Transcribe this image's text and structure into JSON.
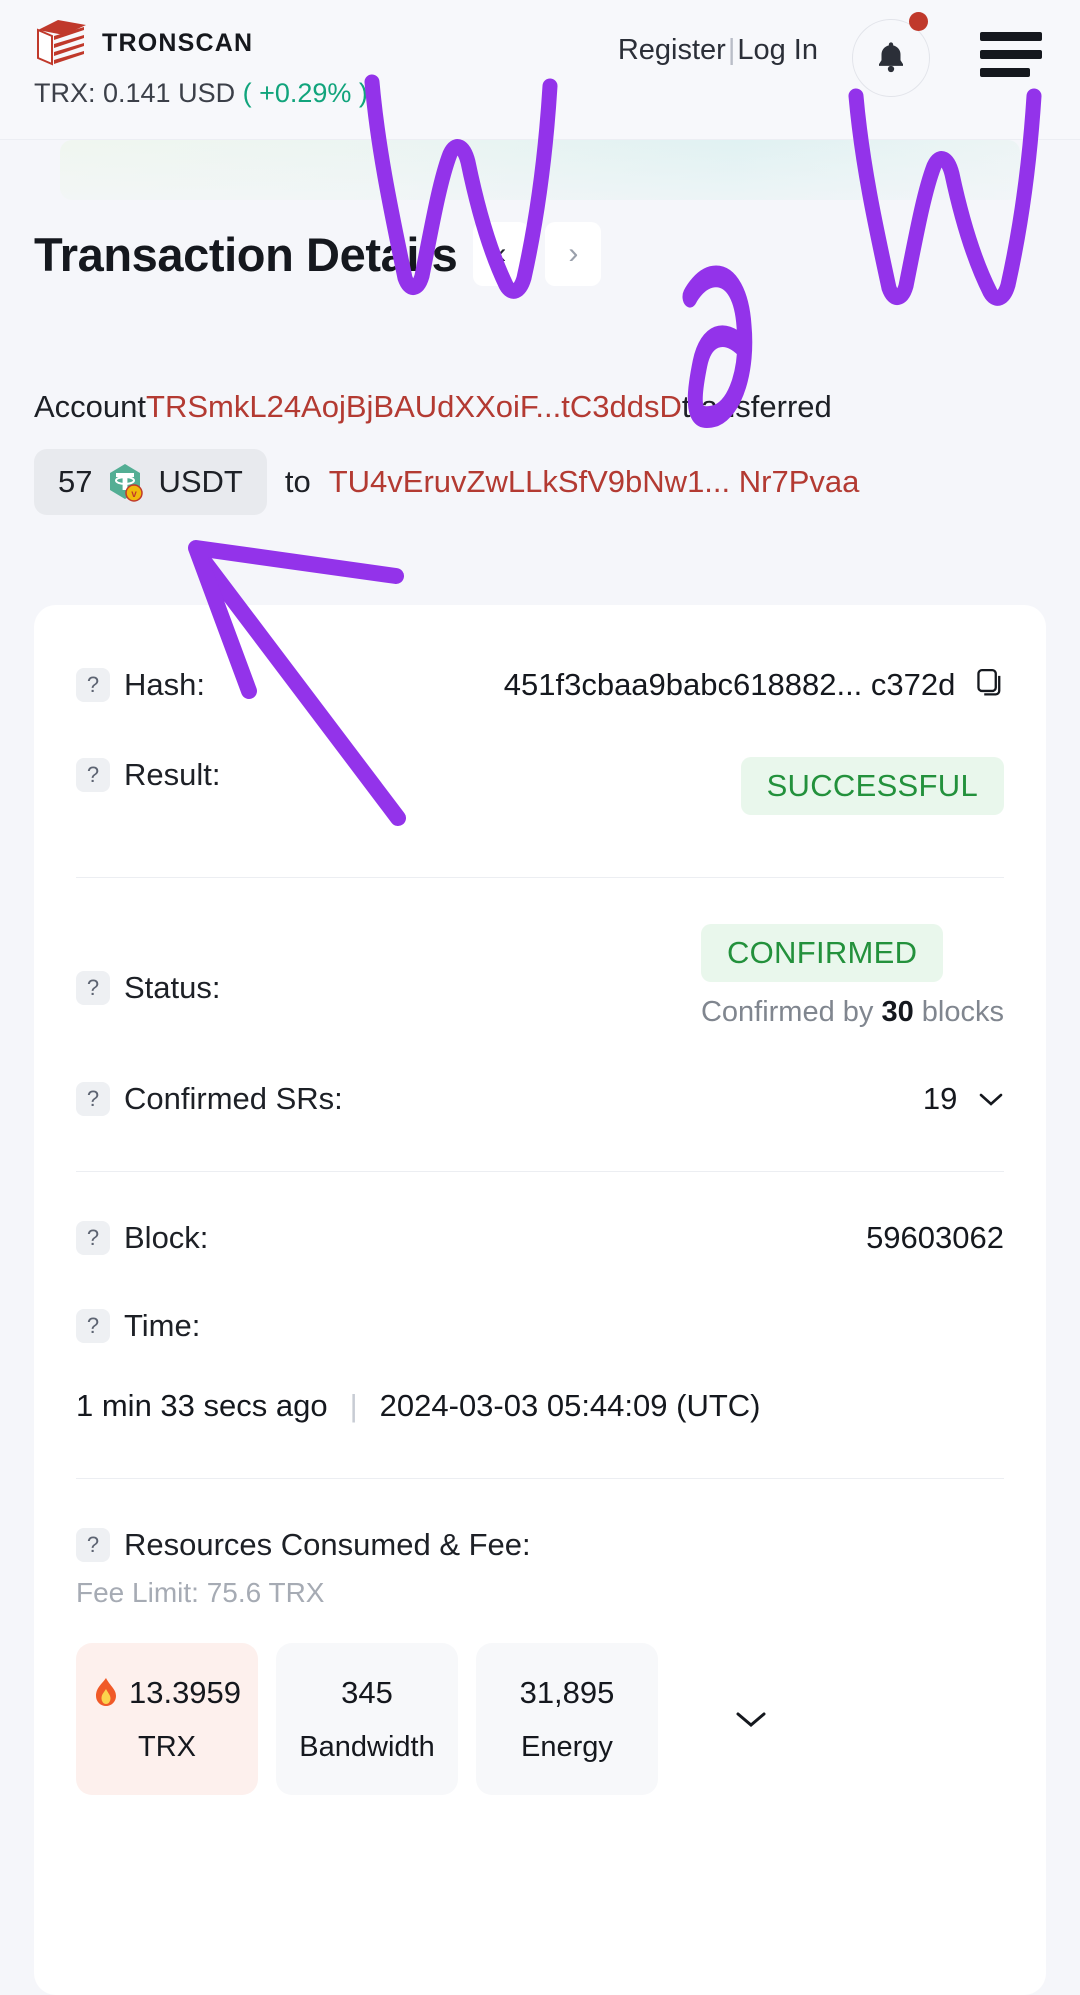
{
  "header": {
    "brand": "TRONSCAN",
    "logo_icon": "tronscan-logo-icon",
    "price_label": "TRX: 0.141 USD",
    "price_change": "( +0.29% )",
    "register_label": "Register",
    "separator": "|",
    "login_label": "Log In",
    "bell_icon": "bell-icon",
    "menu_icon": "hamburger-menu-icon",
    "accent_green": "#11a47c"
  },
  "page": {
    "title": "Transaction Details",
    "prev_icon": "chevron-left-icon",
    "next_icon": "chevron-right-icon"
  },
  "summary": {
    "account_word": "Account",
    "from_address": "TRSmkL24AojBjBAUdXXoiF...tC3ddsD",
    "transferred_word": "transferred",
    "amount": "57",
    "token_icon": "usdt-token-icon",
    "token_symbol": "USDT",
    "to_word": "to",
    "to_address": "TU4vEruvZwLLkSfV9bNw1...  Nr7Pvaa",
    "address_color": "#b33a32"
  },
  "details": {
    "hash": {
      "label": "Hash:",
      "value": "451f3cbaa9babc618882... c372d",
      "copy_icon": "copy-icon"
    },
    "result": {
      "label": "Result:",
      "badge": "SUCCESSFUL",
      "badge_color": "#23913c",
      "badge_bg": "#e9f7ec"
    },
    "status": {
      "label": "Status:",
      "badge": "CONFIRMED",
      "note_prefix": "Confirmed by",
      "note_count": "30",
      "note_suffix": "blocks"
    },
    "confirmed_srs": {
      "label": "Confirmed SRs:",
      "value": "19",
      "chevron_icon": "chevron-down-icon"
    },
    "block": {
      "label": "Block:",
      "value": "59603062"
    },
    "time": {
      "label": "Time:",
      "relative": "1 min 33 secs ago",
      "separator": "|",
      "absolute": "2024-03-03 05:44:09 (UTC)"
    },
    "resources": {
      "label": "Resources Consumed & Fee:",
      "fee_limit": "Fee Limit: 75.6 TRX",
      "expand_icon": "chevron-down-icon",
      "cards": [
        {
          "icon": "fire-icon",
          "value": "13.3959",
          "unit": "TRX",
          "highlight": true
        },
        {
          "icon": "",
          "value": "345",
          "unit": "Bandwidth",
          "highlight": false
        },
        {
          "icon": "",
          "value": "31,895",
          "unit": "Energy",
          "highlight": false
        }
      ]
    }
  },
  "annotation": {
    "text": "WOW",
    "color": "#9333ea"
  }
}
